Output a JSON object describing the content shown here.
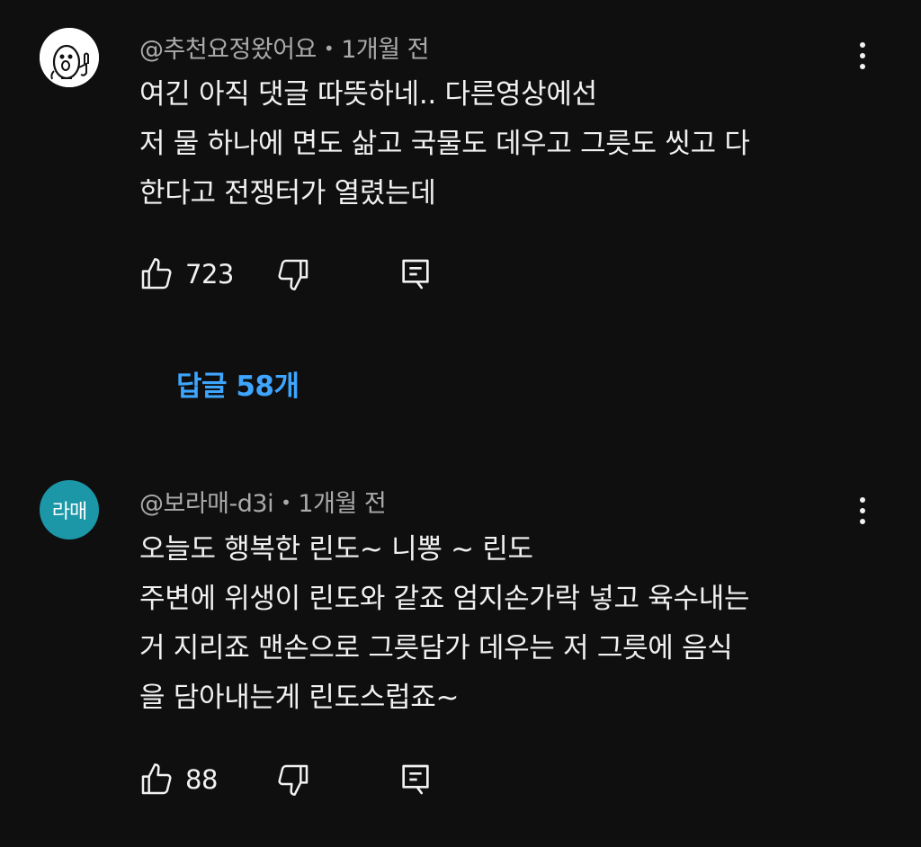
{
  "comments": [
    {
      "author": "@추천요정왔어요",
      "separator": "•",
      "time": "1개월 전",
      "avatar_type": "drawing",
      "text": "여긴 아직 댓글 따뜻하네.. 다른영상에선\n저 물 하나에 면도 삶고 국물도 데우고 그릇도 씻고 다\n한다고 전쟁터가 열렸는데",
      "likes": "723",
      "more_icon": "more-vertical-icon",
      "like_icon": "thumb-up-icon",
      "dislike_icon": "thumb-down-icon",
      "reply_icon": "reply-comment-icon",
      "replies_label": "답글 58개"
    },
    {
      "author": "@보라매-d3i",
      "separator": "•",
      "time": "1개월 전",
      "avatar_type": "initials",
      "avatar_text": "라매",
      "avatar_color": "#1b97a8",
      "text": "오늘도 행복한 린도~ 니뽕 ~ 린도\n주변에 위생이 린도와 같죠 엄지손가락 넣고 육수내는\n거 지리죠 맨손으로 그릇담가 데우는 저 그릇에 음식\n을 담아내는게 린도스럽죠~",
      "likes": "88",
      "more_icon": "more-vertical-icon",
      "like_icon": "thumb-up-icon",
      "dislike_icon": "thumb-down-icon",
      "reply_icon": "reply-comment-icon"
    }
  ],
  "colors": {
    "background": "#0f0f0f",
    "primary_text": "#f1f1f1",
    "secondary_text": "#aaaaaa",
    "link": "#3ea6ff"
  }
}
